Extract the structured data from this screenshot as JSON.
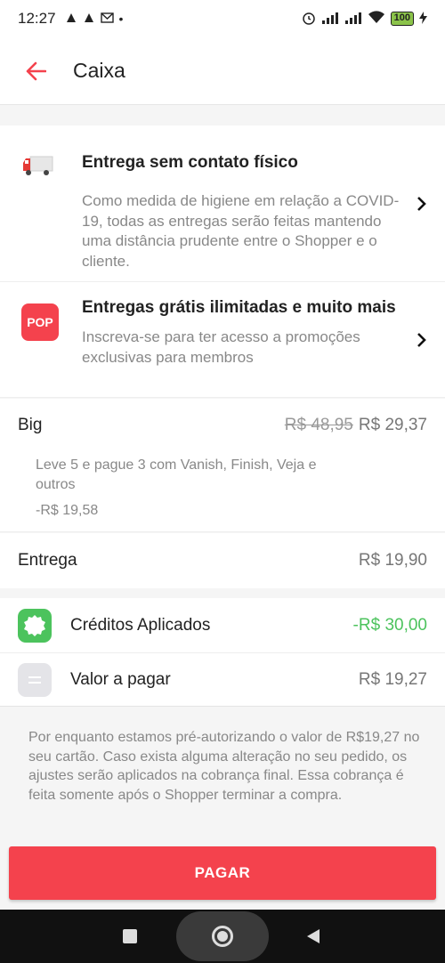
{
  "status_bar": {
    "time": "12:27",
    "battery": "100"
  },
  "header": {
    "title": "Caixa"
  },
  "notices": [
    {
      "title": "Entrega sem contato físico",
      "text": "Como medida de higiene em relação a COVID-19, todas as entregas serão feitas mantendo uma distância prudente entre o Shopper e o cliente."
    },
    {
      "badge": "POP",
      "title": "Entregas grátis ilimitadas e muito mais",
      "text": "Inscreva-se para ter acesso a promoções exclusivas para membros"
    }
  ],
  "store": {
    "name": "Big",
    "old_price": "R$ 48,95",
    "price": "R$ 29,37",
    "promo": "Leve 5 e pague 3 com Vanish, Finish, Veja e outros",
    "discount": "-R$ 19,58"
  },
  "delivery": {
    "label": "Entrega",
    "value": "R$ 19,90"
  },
  "credits": {
    "label": "Créditos Aplicados",
    "value": "-R$ 30,00",
    "color": "#4cc35d"
  },
  "total": {
    "label": "Valor a pagar",
    "value": "R$ 19,27"
  },
  "disclaimer": "Por enquanto estamos pré-autorizando o valor de R$19,27 no seu cartão. Caso exista alguma alteração no seu pedido, os ajustes serão aplicados na cobrança final. Essa cobrança é feita somente após o Shopper terminar a compra.",
  "pay_button": "PAGAR",
  "colors": {
    "accent": "#f4424d",
    "credit_green": "#4cc35d"
  }
}
